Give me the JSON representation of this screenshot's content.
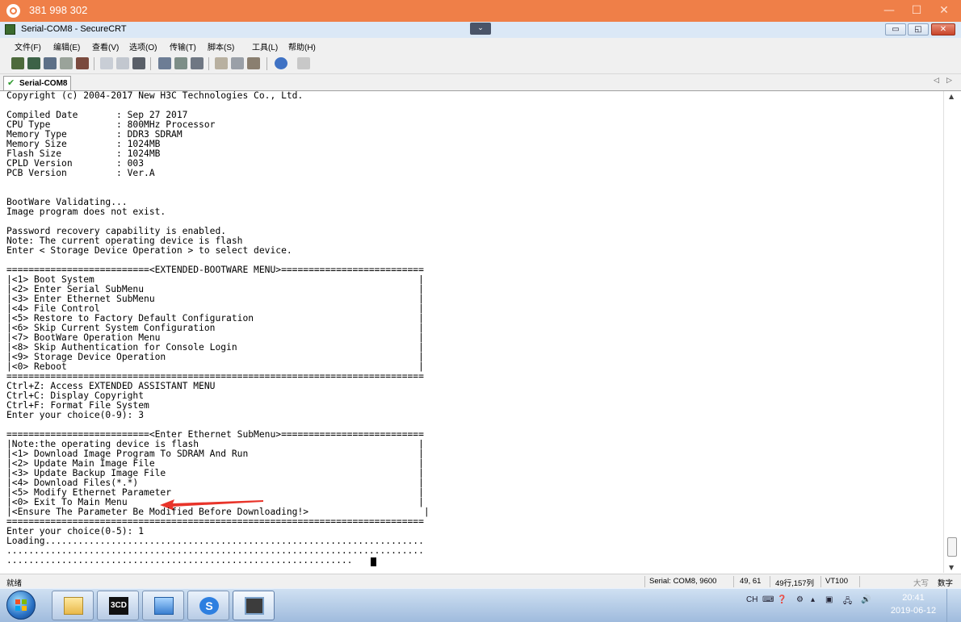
{
  "remote": {
    "id": "381 998 302",
    "min": "—",
    "max": "☐",
    "close": "✕"
  },
  "window": {
    "title": "Serial-COM8 - SecureCRT",
    "dropdown": "⌄",
    "min": "▭",
    "max": "◱",
    "close": "✕"
  },
  "menu": [
    "文件(F)",
    "编辑(E)",
    "查看(V)",
    "选项(O)",
    "传输(T)",
    "脚本(S)",
    "工具(L)",
    "帮助(H)"
  ],
  "tab": {
    "label": "Serial-COM8",
    "check": "✔",
    "nav_left": "◁",
    "nav_right": "▷"
  },
  "terminal": {
    "lines": [
      "Copyright (c) 2004-2017 New H3C Technologies Co., Ltd.",
      "",
      "Compiled Date       : Sep 27 2017",
      "CPU Type            : 800MHz Processor",
      "Memory Type         : DDR3 SDRAM",
      "Memory Size         : 1024MB",
      "Flash Size          : 1024MB",
      "CPLD Version        : 003",
      "PCB Version         : Ver.A",
      "",
      "",
      "BootWare Validating...",
      "Image program does not exist.",
      "",
      "Password recovery capability is enabled.",
      "Note: The current operating device is flash",
      "Enter < Storage Device Operation > to select device.",
      "",
      "==========================<EXTENDED-BOOTWARE MENU>==========================",
      "|<1> Boot System                                                           |",
      "|<2> Enter Serial SubMenu                                                  |",
      "|<3> Enter Ethernet SubMenu                                                |",
      "|<4> File Control                                                          |",
      "|<5> Restore to Factory Default Configuration                              |",
      "|<6> Skip Current System Configuration                                     |",
      "|<7> BootWare Operation Menu                                               |",
      "|<8> Skip Authentication for Console Login                                 |",
      "|<9> Storage Device Operation                                              |",
      "|<0> Reboot                                                                |",
      "============================================================================",
      "Ctrl+Z: Access EXTENDED ASSISTANT MENU",
      "Ctrl+C: Display Copyright",
      "Ctrl+F: Format File System",
      "Enter your choice(0-9): 3",
      "",
      "==========================<Enter Ethernet SubMenu>==========================",
      "|Note:the operating device is flash                                        |",
      "|<1> Download Image Program To SDRAM And Run                               |",
      "|<2> Update Main Image File                                                |",
      "|<3> Update Backup Image File                                              |",
      "|<4> Download Files(*.*)                                                   |",
      "|<5> Modify Ethernet Parameter                                             |",
      "|<0> Exit To Main Menu                                                     |",
      "|<Ensure The Parameter Be Modified Before Downloading!>                     |",
      "============================================================================",
      "Enter your choice(0-5): 1",
      "Loading.....................................................................",
      "............................................................................",
      "..............................................................."
    ]
  },
  "status": {
    "ready": "就绪",
    "serial": "Serial: COM8, 9600",
    "cursor": "49, 61",
    "size": "49行,157列",
    "term": "VT100",
    "caps": "大写",
    "num": "数字"
  },
  "taskbar": {
    "apps": [
      "start",
      "file-explorer",
      "3cd",
      "network-app",
      "sogou",
      "securecrt"
    ],
    "app_3cd_label": "3CD",
    "tray_lang": "CH",
    "time": "20:41",
    "date": "2019-06-12"
  },
  "colors": {
    "remote_bar": "#ef7f48",
    "arrow": "#e8342a",
    "taskbar": "#b7cde8"
  }
}
